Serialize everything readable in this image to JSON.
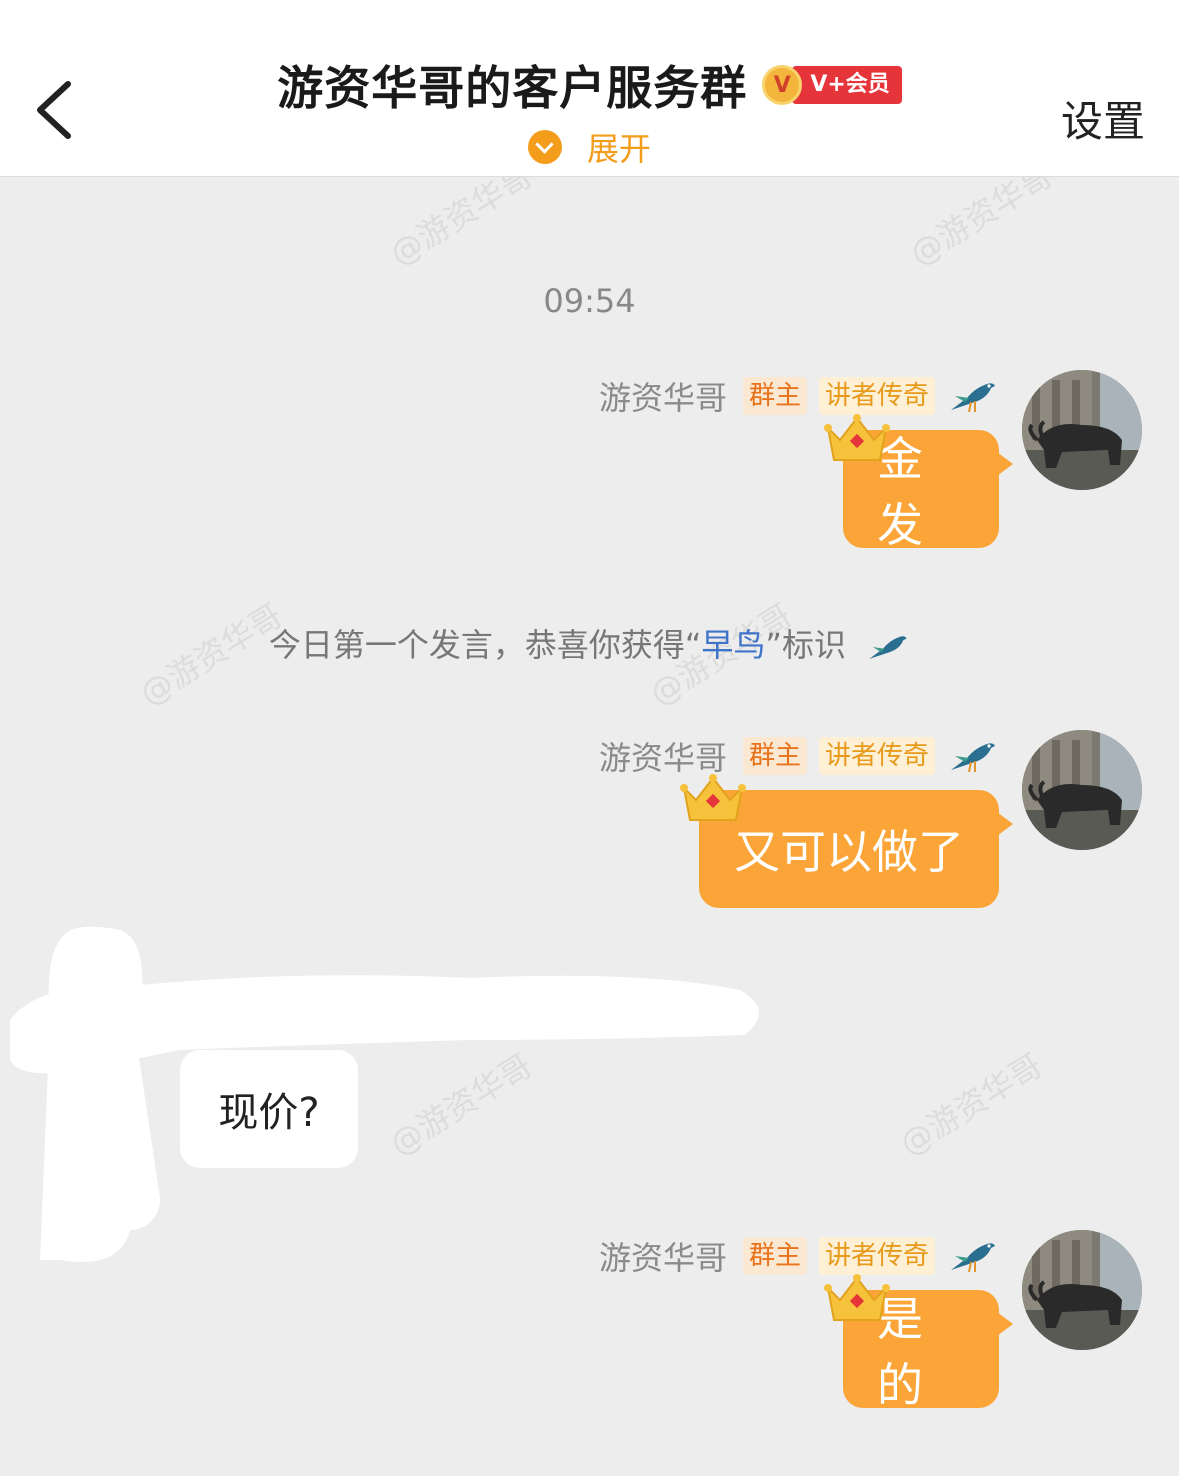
{
  "header": {
    "title": "游资华哥的客户服务群",
    "vip_letter": "V",
    "vip_label": "V+会员",
    "expand_label": "展开",
    "settings_label": "设置"
  },
  "watermark_text": "@游资华哥",
  "timestamp": "09:54",
  "sender": {
    "name": "游资华哥",
    "tag_owner": "群主",
    "tag_legend": "讲者传奇"
  },
  "messages": {
    "m1": "金发",
    "m2": "又可以做了",
    "m3": "现价?",
    "m4": "是的"
  },
  "system": {
    "prefix": "今日第一个发言，恭喜你获得“",
    "highlight": "早鸟",
    "suffix": "”标识"
  },
  "colors": {
    "accent_orange": "#fba437",
    "owner_tag": "#e8731b",
    "vip_red": "#e5353a",
    "link_blue": "#3f74c8"
  }
}
